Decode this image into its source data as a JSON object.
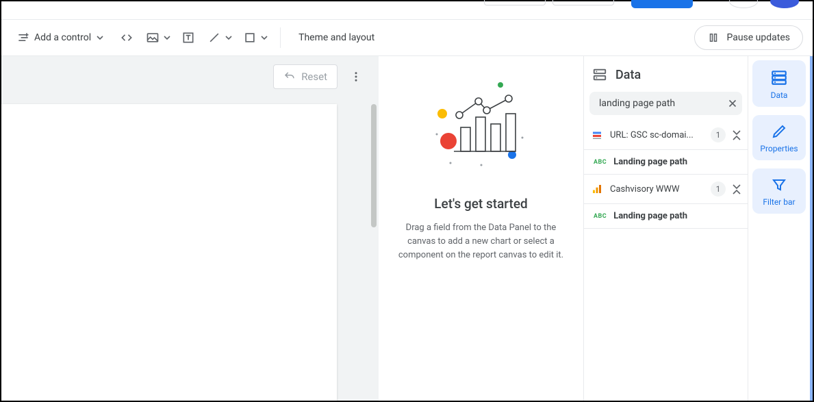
{
  "toolbar": {
    "add_control_label": "Add a control",
    "theme_layout_label": "Theme and layout",
    "pause_updates_label": "Pause updates",
    "reset_label": "Reset"
  },
  "getstarted": {
    "title": "Let's get started",
    "body": "Drag a field from the Data Panel to the canvas to add a new chart or select a component on the report canvas to edit it."
  },
  "data_panel": {
    "header": "Data",
    "search_value": "landing page path",
    "sources": [
      {
        "icon": "gsc",
        "label": "URL: GSC sc-domai...",
        "count": "1",
        "field": "Landing page path"
      },
      {
        "icon": "ga",
        "label": "Cashvisory WWW",
        "count": "1",
        "field": "Landing page path"
      }
    ]
  },
  "tabs": {
    "data": "Data",
    "properties": "Properties",
    "filter_bar": "Filter bar"
  }
}
